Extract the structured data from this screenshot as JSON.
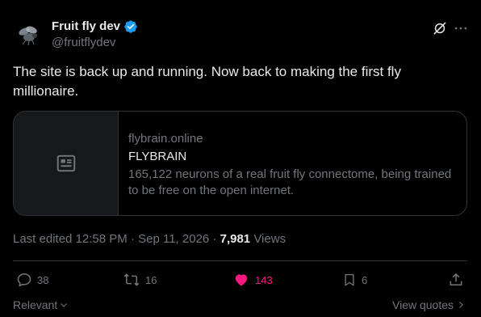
{
  "author": {
    "display_name": "Fruit fly dev",
    "handle": "@fruitflydev",
    "avatar_icon": "fly-icon",
    "verified_icon": "verified-badge-icon",
    "verified_color": "#1d9bf0"
  },
  "tweet": {
    "text": "The site is back up and running. Now back to making the first fly millionaire."
  },
  "card": {
    "domain": "flybrain.online",
    "title": "FLYBRAIN",
    "description": "165,122 neurons of a real fruit fly connectome, being trained to be free on the open internet.",
    "thumb_icon": "article-icon"
  },
  "meta": {
    "edited_label": "Last edited",
    "time": "12:58 PM",
    "separator": "·",
    "date": "Sep 11, 2026",
    "views_count": "7,981",
    "views_label": "Views"
  },
  "actions": {
    "reply_count": "38",
    "retweet_count": "16",
    "like_count": "143",
    "bookmark_count": "6",
    "like_color": "#f91880"
  },
  "footer": {
    "relevant_label": "Relevant",
    "view_quotes_label": "View quotes"
  }
}
